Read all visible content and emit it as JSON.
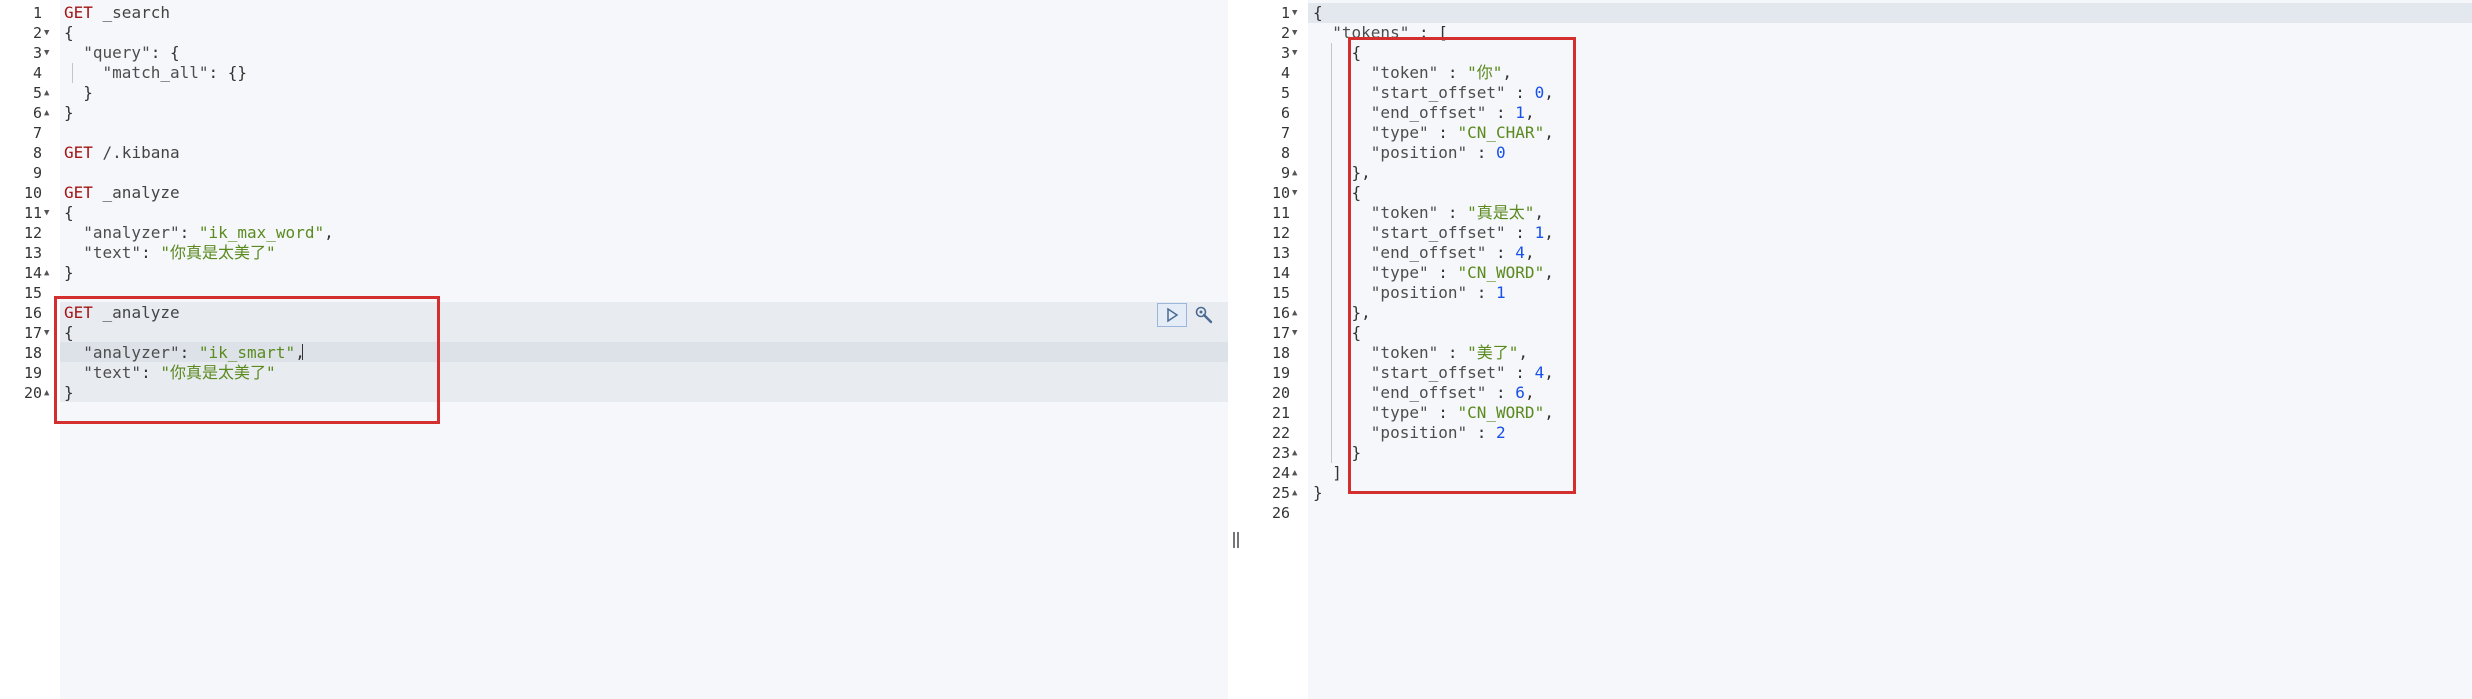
{
  "request_editor": {
    "lines": [
      {
        "n": "1",
        "fold": "",
        "parts": [
          {
            "t": "GET",
            "c": "method"
          },
          {
            "t": " _search",
            "c": "url"
          }
        ]
      },
      {
        "n": "2",
        "fold": "▼",
        "parts": [
          {
            "t": "{",
            "c": "punc"
          }
        ]
      },
      {
        "n": "3",
        "fold": "▼",
        "parts": [
          {
            "t": "  \"query\"",
            "c": "key"
          },
          {
            "t": ": {",
            "c": "punc"
          }
        ]
      },
      {
        "n": "4",
        "fold": "",
        "parts": [
          {
            "t": "    \"match_all\"",
            "c": "key"
          },
          {
            "t": ": {}",
            "c": "punc"
          }
        ]
      },
      {
        "n": "5",
        "fold": "▲",
        "parts": [
          {
            "t": "  }",
            "c": "punc"
          }
        ]
      },
      {
        "n": "6",
        "fold": "▲",
        "parts": [
          {
            "t": "}",
            "c": "punc"
          }
        ]
      },
      {
        "n": "7",
        "fold": "",
        "parts": []
      },
      {
        "n": "8",
        "fold": "",
        "parts": [
          {
            "t": "GET",
            "c": "method"
          },
          {
            "t": " /.kibana",
            "c": "url"
          }
        ]
      },
      {
        "n": "9",
        "fold": "",
        "parts": []
      },
      {
        "n": "10",
        "fold": "",
        "parts": [
          {
            "t": "GET",
            "c": "method"
          },
          {
            "t": " _analyze",
            "c": "url"
          }
        ]
      },
      {
        "n": "11",
        "fold": "▼",
        "parts": [
          {
            "t": "{",
            "c": "punc"
          }
        ]
      },
      {
        "n": "12",
        "fold": "",
        "parts": [
          {
            "t": "  \"analyzer\"",
            "c": "key"
          },
          {
            "t": ": ",
            "c": "punc"
          },
          {
            "t": "\"ik_max_word\"",
            "c": "str"
          },
          {
            "t": ",",
            "c": "punc"
          }
        ]
      },
      {
        "n": "13",
        "fold": "",
        "parts": [
          {
            "t": "  \"text\"",
            "c": "key"
          },
          {
            "t": ": ",
            "c": "punc"
          },
          {
            "t": "\"你真是太美了\"",
            "c": "str"
          }
        ]
      },
      {
        "n": "14",
        "fold": "▲",
        "parts": [
          {
            "t": "}",
            "c": "punc"
          }
        ]
      },
      {
        "n": "15",
        "fold": "",
        "parts": []
      },
      {
        "n": "16",
        "fold": "",
        "parts": [
          {
            "t": "GET",
            "c": "method"
          },
          {
            "t": " _analyze",
            "c": "url"
          }
        ]
      },
      {
        "n": "17",
        "fold": "▼",
        "parts": [
          {
            "t": "{",
            "c": "punc"
          }
        ]
      },
      {
        "n": "18",
        "fold": "",
        "parts": [
          {
            "t": "  \"analyzer\"",
            "c": "key"
          },
          {
            "t": ": ",
            "c": "punc"
          },
          {
            "t": "\"ik_smart\"",
            "c": "str"
          },
          {
            "t": ",",
            "c": "punc"
          }
        ]
      },
      {
        "n": "19",
        "fold": "",
        "parts": [
          {
            "t": "  \"text\"",
            "c": "key"
          },
          {
            "t": ": ",
            "c": "punc"
          },
          {
            "t": "\"你真是太美了\"",
            "c": "str"
          }
        ]
      },
      {
        "n": "20",
        "fold": "▲",
        "parts": [
          {
            "t": "}",
            "c": "punc"
          }
        ]
      }
    ]
  },
  "response_viewer": {
    "lines": [
      {
        "n": "1",
        "fold": "▼",
        "parts": [
          {
            "t": "{",
            "c": "punc"
          }
        ]
      },
      {
        "n": "2",
        "fold": "▼",
        "parts": [
          {
            "t": "  \"tokens\"",
            "c": "key"
          },
          {
            "t": " : [",
            "c": "punc"
          }
        ]
      },
      {
        "n": "3",
        "fold": "▼",
        "parts": [
          {
            "t": "    {",
            "c": "punc"
          }
        ]
      },
      {
        "n": "4",
        "fold": "",
        "parts": [
          {
            "t": "      \"token\"",
            "c": "key"
          },
          {
            "t": " : ",
            "c": "punc"
          },
          {
            "t": "\"你\"",
            "c": "str"
          },
          {
            "t": ",",
            "c": "punc"
          }
        ]
      },
      {
        "n": "5",
        "fold": "",
        "parts": [
          {
            "t": "      \"start_offset\"",
            "c": "key"
          },
          {
            "t": " : ",
            "c": "punc"
          },
          {
            "t": "0",
            "c": "num"
          },
          {
            "t": ",",
            "c": "punc"
          }
        ]
      },
      {
        "n": "6",
        "fold": "",
        "parts": [
          {
            "t": "      \"end_offset\"",
            "c": "key"
          },
          {
            "t": " : ",
            "c": "punc"
          },
          {
            "t": "1",
            "c": "num"
          },
          {
            "t": ",",
            "c": "punc"
          }
        ]
      },
      {
        "n": "7",
        "fold": "",
        "parts": [
          {
            "t": "      \"type\"",
            "c": "key"
          },
          {
            "t": " : ",
            "c": "punc"
          },
          {
            "t": "\"CN_CHAR\"",
            "c": "str"
          },
          {
            "t": ",",
            "c": "punc"
          }
        ]
      },
      {
        "n": "8",
        "fold": "",
        "parts": [
          {
            "t": "      \"position\"",
            "c": "key"
          },
          {
            "t": " : ",
            "c": "punc"
          },
          {
            "t": "0",
            "c": "num"
          }
        ]
      },
      {
        "n": "9",
        "fold": "▲",
        "parts": [
          {
            "t": "    },",
            "c": "punc"
          }
        ]
      },
      {
        "n": "10",
        "fold": "▼",
        "parts": [
          {
            "t": "    {",
            "c": "punc"
          }
        ]
      },
      {
        "n": "11",
        "fold": "",
        "parts": [
          {
            "t": "      \"token\"",
            "c": "key"
          },
          {
            "t": " : ",
            "c": "punc"
          },
          {
            "t": "\"真是太\"",
            "c": "str"
          },
          {
            "t": ",",
            "c": "punc"
          }
        ]
      },
      {
        "n": "12",
        "fold": "",
        "parts": [
          {
            "t": "      \"start_offset\"",
            "c": "key"
          },
          {
            "t": " : ",
            "c": "punc"
          },
          {
            "t": "1",
            "c": "num"
          },
          {
            "t": ",",
            "c": "punc"
          }
        ]
      },
      {
        "n": "13",
        "fold": "",
        "parts": [
          {
            "t": "      \"end_offset\"",
            "c": "key"
          },
          {
            "t": " : ",
            "c": "punc"
          },
          {
            "t": "4",
            "c": "num"
          },
          {
            "t": ",",
            "c": "punc"
          }
        ]
      },
      {
        "n": "14",
        "fold": "",
        "parts": [
          {
            "t": "      \"type\"",
            "c": "key"
          },
          {
            "t": " : ",
            "c": "punc"
          },
          {
            "t": "\"CN_WORD\"",
            "c": "str"
          },
          {
            "t": ",",
            "c": "punc"
          }
        ]
      },
      {
        "n": "15",
        "fold": "",
        "parts": [
          {
            "t": "      \"position\"",
            "c": "key"
          },
          {
            "t": " : ",
            "c": "punc"
          },
          {
            "t": "1",
            "c": "num"
          }
        ]
      },
      {
        "n": "16",
        "fold": "▲",
        "parts": [
          {
            "t": "    },",
            "c": "punc"
          }
        ]
      },
      {
        "n": "17",
        "fold": "▼",
        "parts": [
          {
            "t": "    {",
            "c": "punc"
          }
        ]
      },
      {
        "n": "18",
        "fold": "",
        "parts": [
          {
            "t": "      \"token\"",
            "c": "key"
          },
          {
            "t": " : ",
            "c": "punc"
          },
          {
            "t": "\"美了\"",
            "c": "str"
          },
          {
            "t": ",",
            "c": "punc"
          }
        ]
      },
      {
        "n": "19",
        "fold": "",
        "parts": [
          {
            "t": "      \"start_offset\"",
            "c": "key"
          },
          {
            "t": " : ",
            "c": "punc"
          },
          {
            "t": "4",
            "c": "num"
          },
          {
            "t": ",",
            "c": "punc"
          }
        ]
      },
      {
        "n": "20",
        "fold": "",
        "parts": [
          {
            "t": "      \"end_offset\"",
            "c": "key"
          },
          {
            "t": " : ",
            "c": "punc"
          },
          {
            "t": "6",
            "c": "num"
          },
          {
            "t": ",",
            "c": "punc"
          }
        ]
      },
      {
        "n": "21",
        "fold": "",
        "parts": [
          {
            "t": "      \"type\"",
            "c": "key"
          },
          {
            "t": " : ",
            "c": "punc"
          },
          {
            "t": "\"CN_WORD\"",
            "c": "str"
          },
          {
            "t": ",",
            "c": "punc"
          }
        ]
      },
      {
        "n": "22",
        "fold": "",
        "parts": [
          {
            "t": "      \"position\"",
            "c": "key"
          },
          {
            "t": " : ",
            "c": "punc"
          },
          {
            "t": "2",
            "c": "num"
          }
        ]
      },
      {
        "n": "23",
        "fold": "▲",
        "parts": [
          {
            "t": "    }",
            "c": "punc"
          }
        ]
      },
      {
        "n": "24",
        "fold": "▲",
        "parts": [
          {
            "t": "  ]",
            "c": "punc"
          }
        ]
      },
      {
        "n": "25",
        "fold": "▲",
        "parts": [
          {
            "t": "}",
            "c": "punc"
          }
        ]
      },
      {
        "n": "26",
        "fold": "",
        "parts": []
      }
    ]
  },
  "icons": {
    "run": "play-icon",
    "settings": "wrench-icon",
    "resizer": "drag-handle-icon"
  },
  "colors": {
    "highlight": "#d32f2f",
    "editor_bg": "#f5f7fa",
    "method": "#a31515",
    "string": "#5b8a1f",
    "number": "#1750eb"
  }
}
